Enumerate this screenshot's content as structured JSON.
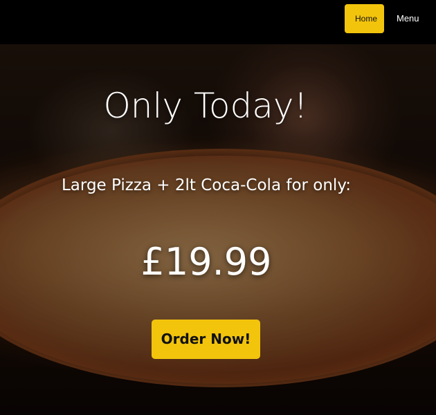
{
  "nav": {
    "home_label": "Home",
    "menu_label": "Menu"
  },
  "hero": {
    "headline": "Only Today!",
    "subline": "Large Pizza + 2lt Coca-Cola for only:",
    "price": "£19.99",
    "cta_label": "Order Now!"
  },
  "colors": {
    "accent": "#f2c40c",
    "navbar": "#000000",
    "text": "#ffffff"
  }
}
